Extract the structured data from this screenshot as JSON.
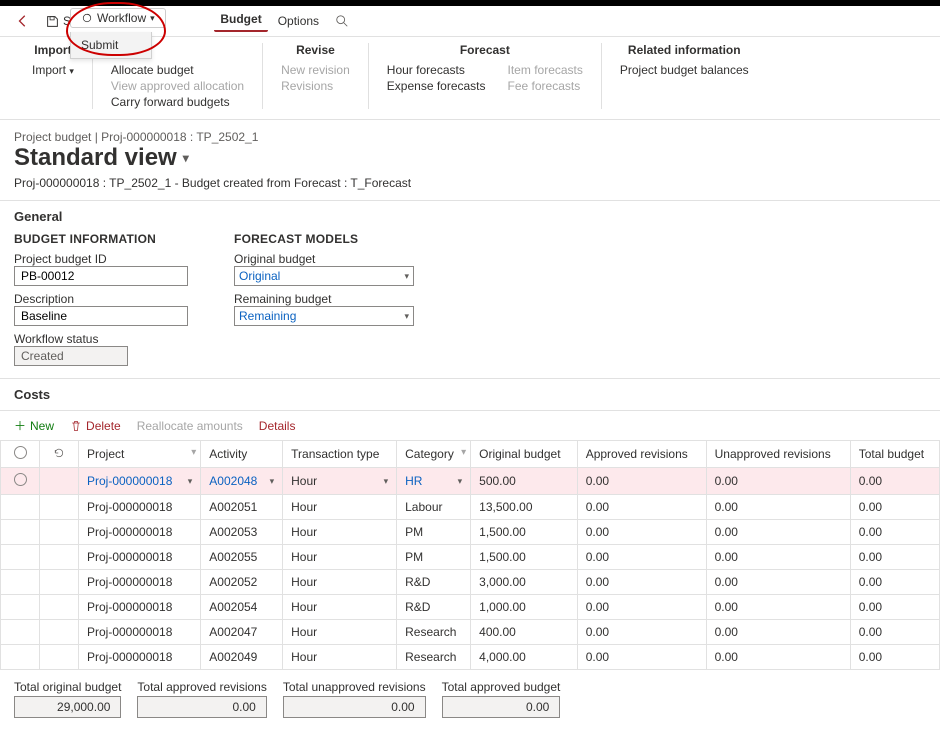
{
  "toolbar": {
    "save": "Save",
    "workflow": "Workflow",
    "workflow_menu": {
      "submit": "Submit"
    },
    "budget": "Budget",
    "options": "Options"
  },
  "ribbon": {
    "import": {
      "title": "Import",
      "btn": "Import"
    },
    "manage": {
      "allocate": "Allocate budget",
      "view_appr": "View approved allocation",
      "carry": "Carry forward budgets"
    },
    "revise": {
      "title": "Revise",
      "new_rev": "New revision",
      "revisions": "Revisions"
    },
    "forecast": {
      "title": "Forecast",
      "hour": "Hour forecasts",
      "expense": "Expense forecasts",
      "item": "Item forecasts",
      "fee": "Fee forecasts"
    },
    "related": {
      "title": "Related information",
      "balances": "Project budget balances"
    }
  },
  "header": {
    "crumb": "Project budget  |  Proj-000000018 : TP_2502_1",
    "view": "Standard view",
    "sub": "Proj-000000018 : TP_2502_1 - Budget created from Forecast : T_Forecast"
  },
  "general": {
    "title": "General",
    "bi_title": "BUDGET INFORMATION",
    "fm_title": "FORECAST MODELS",
    "pbid_label": "Project budget ID",
    "pbid_value": "PB-00012",
    "desc_label": "Description",
    "desc_value": "Baseline",
    "wf_label": "Workflow status",
    "wf_value": "Created",
    "orig_label": "Original budget",
    "orig_value": "Original",
    "rem_label": "Remaining budget",
    "rem_value": "Remaining"
  },
  "costs": {
    "title": "Costs",
    "new": "New",
    "delete": "Delete",
    "realloc": "Reallocate amounts",
    "details": "Details",
    "cols": {
      "project": "Project",
      "activity": "Activity",
      "ttype": "Transaction type",
      "category": "Category",
      "orig": "Original budget",
      "apr": "Approved revisions",
      "unapr": "Unapproved revisions",
      "total": "Total budget"
    },
    "rows": [
      {
        "project": "Proj-000000018",
        "activity": "A002048",
        "ttype": "Hour",
        "category": "HR",
        "orig": "500.00",
        "apr": "0.00",
        "unapr": "0.00",
        "total": "0.00",
        "active": true
      },
      {
        "project": "Proj-000000018",
        "activity": "A002051",
        "ttype": "Hour",
        "category": "Labour",
        "orig": "13,500.00",
        "apr": "0.00",
        "unapr": "0.00",
        "total": "0.00"
      },
      {
        "project": "Proj-000000018",
        "activity": "A002053",
        "ttype": "Hour",
        "category": "PM",
        "orig": "1,500.00",
        "apr": "0.00",
        "unapr": "0.00",
        "total": "0.00"
      },
      {
        "project": "Proj-000000018",
        "activity": "A002055",
        "ttype": "Hour",
        "category": "PM",
        "orig": "1,500.00",
        "apr": "0.00",
        "unapr": "0.00",
        "total": "0.00"
      },
      {
        "project": "Proj-000000018",
        "activity": "A002052",
        "ttype": "Hour",
        "category": "R&D",
        "orig": "3,000.00",
        "apr": "0.00",
        "unapr": "0.00",
        "total": "0.00"
      },
      {
        "project": "Proj-000000018",
        "activity": "A002054",
        "ttype": "Hour",
        "category": "R&D",
        "orig": "1,000.00",
        "apr": "0.00",
        "unapr": "0.00",
        "total": "0.00"
      },
      {
        "project": "Proj-000000018",
        "activity": "A002047",
        "ttype": "Hour",
        "category": "Research",
        "orig": "400.00",
        "apr": "0.00",
        "unapr": "0.00",
        "total": "0.00"
      },
      {
        "project": "Proj-000000018",
        "activity": "A002049",
        "ttype": "Hour",
        "category": "Research",
        "orig": "4,000.00",
        "apr": "0.00",
        "unapr": "0.00",
        "total": "0.00"
      }
    ]
  },
  "totals": {
    "orig_l": "Total original budget",
    "orig_v": "29,000.00",
    "apr_l": "Total approved revisions",
    "apr_v": "0.00",
    "unapr_l": "Total unapproved revisions",
    "unapr_v": "0.00",
    "tbud_l": "Total approved budget",
    "tbud_v": "0.00"
  }
}
